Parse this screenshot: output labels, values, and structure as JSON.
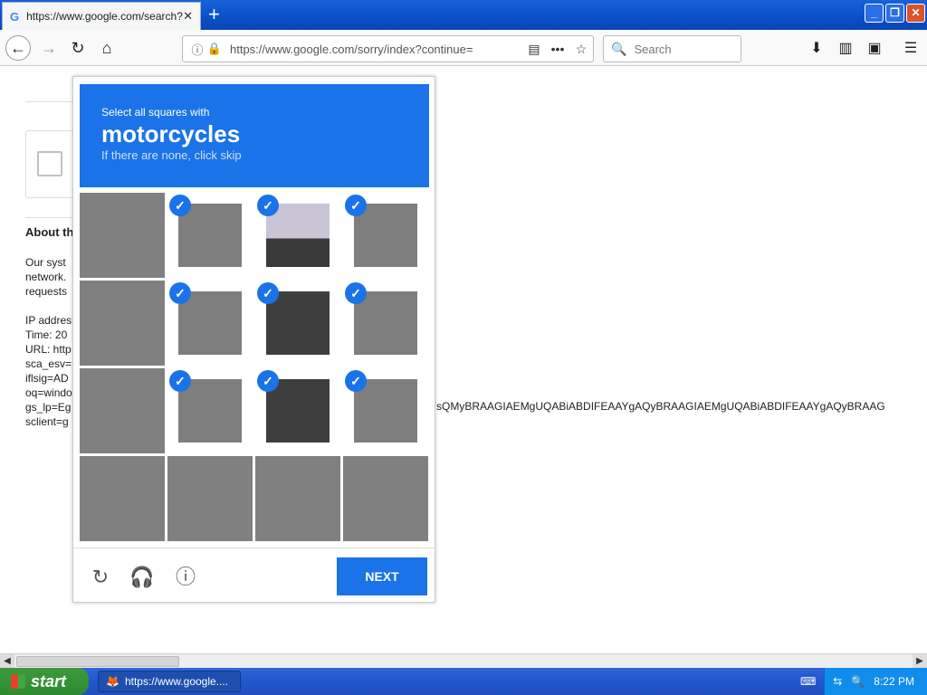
{
  "browser": {
    "tab_title": "https://www.google.com/search?q",
    "tab_icon": "G",
    "url": "https://www.google.com/sorry/index?continue=",
    "search_placeholder": "Search"
  },
  "page": {
    "about_heading": "About th",
    "body_lines": "Our syst\nnetwork.\nrequests\n\nIP addres\nTime: 20\nURL: http\nsca_esv=\niflsig=AD\noq=windo\ngs_lp=Eg\nsclient=g",
    "gs_lp_tail": "YsQMyBRAAGIAEMgUQABiABDIFEAAYgAQyBRAAGIAEMgUQABiABDIFEAAYgAQyBRAAG"
  },
  "captcha": {
    "instruction": "Select all squares with",
    "target": "motorcycles",
    "hint": "If there are none, click skip",
    "next_label": "NEXT",
    "selected_tiles": [
      1,
      2,
      3,
      5,
      6,
      7,
      9,
      10,
      11
    ]
  },
  "taskbar": {
    "start_label": "start",
    "task_label": "https://www.google....",
    "clock": "8:22 PM"
  }
}
